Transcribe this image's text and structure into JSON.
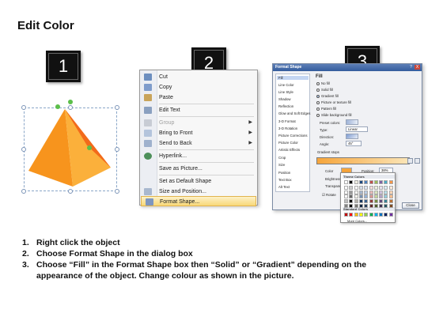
{
  "slide": {
    "title": "Edit Color"
  },
  "steps": {
    "badges": [
      "1",
      "2",
      "3"
    ],
    "instructions": [
      {
        "num": "1.",
        "text": "Right click the object"
      },
      {
        "num": "2.",
        "text": "Choose Format Shape in the dialog box"
      },
      {
        "num": "3.",
        "text": "Choose “Fill” in the Format Shape box then “Solid” or “Gradient” depending on the appearance of the object. Change colour as shown in the picture."
      }
    ]
  },
  "shape": {
    "type": "pyramid",
    "colors": {
      "light": "#fbb03b",
      "mid": "#f7941d",
      "dark": "#f26a1b",
      "shadow": "#e8830f"
    }
  },
  "context_menu": {
    "items": [
      {
        "label": "Cut",
        "icon": "scissors-icon",
        "disabled": false
      },
      {
        "label": "Copy",
        "icon": "copy-icon",
        "disabled": false
      },
      {
        "label": "Paste",
        "icon": "paste-icon",
        "disabled": false
      },
      {
        "label": "Edit Text",
        "icon": "edit-text-icon",
        "disabled": false
      },
      {
        "label": "Group",
        "icon": "group-icon",
        "disabled": true,
        "submenu": true
      },
      {
        "label": "Bring to Front",
        "icon": "bring-front-icon",
        "disabled": false,
        "submenu": true
      },
      {
        "label": "Send to Back",
        "icon": "send-back-icon",
        "disabled": false,
        "submenu": true
      },
      {
        "label": "Hyperlink...",
        "icon": "hyperlink-icon",
        "disabled": false
      },
      {
        "label": "Save as Picture...",
        "icon": "",
        "disabled": false
      },
      {
        "label": "Set as Default Shape",
        "icon": "",
        "disabled": false
      },
      {
        "label": "Size and Position...",
        "icon": "size-position-icon",
        "disabled": false
      },
      {
        "label": "Format Shape...",
        "icon": "format-shape-icon",
        "disabled": false,
        "highlighted": true
      }
    ]
  },
  "format_dialog": {
    "title": "Format Shape",
    "controls": [
      "?",
      "X"
    ],
    "nav": [
      "Fill",
      "Line Color",
      "Line Style",
      "Shadow",
      "Reflection",
      "Glow and Soft Edges",
      "3-D Format",
      "3-D Rotation",
      "Picture Corrections",
      "Picture Color",
      "Artistic Effects",
      "Crop",
      "Size",
      "Position",
      "Text Box",
      "Alt Text"
    ],
    "selected_nav": "Fill",
    "section_title": "Fill",
    "fill_options": [
      "No fill",
      "Solid fill",
      "Gradient fill",
      "Picture or texture fill",
      "Pattern fill",
      "Slide background fill"
    ],
    "selected_fill": "Gradient fill",
    "preset_colors_label": "Preset colors:",
    "type_label": "Type:",
    "type_value": "Linear",
    "direction_label": "Direction:",
    "angle_label": "Angle:",
    "angle_value": "45°",
    "gradient_stops_label": "Gradient stops",
    "color_label": "Color",
    "position_label": "Position:",
    "position_value": "38%",
    "brightness_label": "Brightness",
    "transparency_label": "Transparency",
    "rotate_label": "Rotate",
    "close_label": "Close",
    "gradient_colors": {
      "start": "#f6a53b",
      "end": "#fbe6b8"
    }
  },
  "color_picker": {
    "theme_colors_label": "Theme Colors",
    "standard_colors_label": "Standard Colors",
    "more_colors_label": "More Colors...",
    "theme_top_row": [
      "#ffffff",
      "#000000",
      "#eeece1",
      "#1f497d",
      "#4f81bd",
      "#c0504d",
      "#9bbb59",
      "#8064a2",
      "#4bacc6",
      "#f79646"
    ],
    "standard_row": [
      "#c00000",
      "#ff0000",
      "#ffc000",
      "#ffff00",
      "#92d050",
      "#00b050",
      "#00b0f0",
      "#0070c0",
      "#002060",
      "#7030a0"
    ]
  }
}
